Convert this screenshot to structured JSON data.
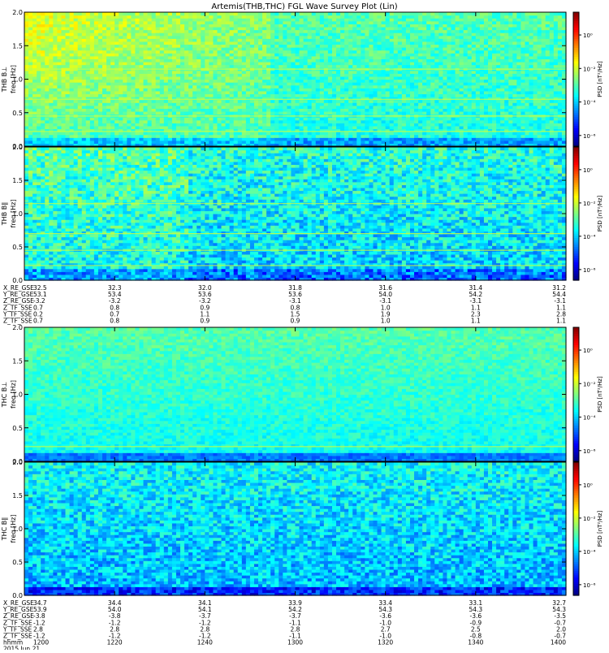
{
  "title": "Artemis(THB,THC) FGL Wave Survey Plot (Lin)",
  "colors": {
    "background": "#ffffff",
    "axis": "#000000",
    "colormap": [
      "#000080",
      "#0000ff",
      "#0080ff",
      "#00ffff",
      "#80ff80",
      "#ffff00",
      "#ff8000",
      "#ff0000",
      "#800000"
    ]
  },
  "chart_data": [
    {
      "type": "heatmap",
      "panel": "thb_bperp",
      "ylabel_probe": "THB B⊥",
      "ylabel": "freq [Hz]",
      "ylim": [
        0,
        2.0
      ],
      "yticks": [
        "0.0",
        "0.5",
        "1.0",
        "1.5",
        "2.0"
      ],
      "colorbar_label": "PSD [nT²/Hz]",
      "colorbar_ticks": [
        "10⁰",
        "10⁻²",
        "10⁻⁴",
        "10⁻⁶"
      ],
      "log_color_scale": true,
      "spectral_lines_hz": [
        0.22,
        0.45,
        0.7,
        1.15
      ]
    },
    {
      "type": "heatmap",
      "panel": "thb_bpar",
      "ylabel_probe": "THB B∥",
      "ylabel": "freq [Hz]",
      "ylim": [
        0,
        2.0
      ],
      "yticks": [
        "0.0",
        "0.5",
        "1.0",
        "1.5",
        "2.0"
      ],
      "colorbar_label": "PSD [nT²/Hz]",
      "colorbar_ticks": [
        "10⁰",
        "10⁻²",
        "10⁻⁴",
        "10⁻⁶"
      ],
      "log_color_scale": true,
      "spectral_lines_hz": [
        0.22,
        0.45,
        0.7,
        1.15
      ]
    },
    {
      "type": "heatmap",
      "panel": "thc_bperp",
      "ylabel_probe": "THC B⊥",
      "ylabel": "freq [Hz]",
      "ylim": [
        0,
        2.0
      ],
      "yticks": [
        "0.0",
        "0.5",
        "1.0",
        "1.5",
        "2.0"
      ],
      "colorbar_label": "PSD [nT²/Hz]",
      "colorbar_ticks": [
        "10⁰",
        "10⁻²",
        "10⁻⁴",
        "10⁻⁶"
      ],
      "log_color_scale": true,
      "spectral_lines_hz": [
        0.22
      ]
    },
    {
      "type": "heatmap",
      "panel": "thc_bpar",
      "ylabel_probe": "THC B∥",
      "ylabel": "freq [Hz]",
      "ylim": [
        0,
        2.0
      ],
      "yticks": [
        "0.0",
        "0.5",
        "1.0",
        "1.5",
        "2.0"
      ],
      "colorbar_label": "PSD [nT²/Hz]",
      "colorbar_ticks": [
        "10⁰",
        "10⁻²",
        "10⁻⁴",
        "10⁻⁶"
      ],
      "log_color_scale": true,
      "spectral_lines_hz": []
    }
  ],
  "thb_ephemeris": {
    "rows": [
      {
        "label": "X_RE_GSE",
        "values": [
          "32.5",
          "32.3",
          "32.0",
          "31.8",
          "31.6",
          "31.4",
          "31.2"
        ]
      },
      {
        "label": "Y_RE_GSE",
        "values": [
          "53.1",
          "53.4",
          "53.6",
          "53.6",
          "54.0",
          "54.2",
          "54.4"
        ]
      },
      {
        "label": "Z_RE_GSE",
        "values": [
          "-3.2",
          "-3.2",
          "-3.2",
          "-3.1",
          "-3.1",
          "-3.1",
          "-3.1"
        ]
      },
      {
        "label": "Z_TF_SSE",
        "values": [
          "0.7",
          "0.8",
          "0.9",
          "0.8",
          "1.0",
          "1.1",
          "1.1"
        ]
      },
      {
        "label": "Y_TF_SSE",
        "values": [
          "0.2",
          "0.7",
          "1.1",
          "1.5",
          "1.9",
          "2.3",
          "2.8"
        ]
      },
      {
        "label": "Z_TF_SSE",
        "values": [
          "0.7",
          "0.8",
          "0.9",
          "0.9",
          "1.0",
          "1.1",
          "1.1"
        ]
      }
    ]
  },
  "thc_ephemeris": {
    "rows": [
      {
        "label": "X_RE_GSE",
        "values": [
          "34.7",
          "34.4",
          "34.1",
          "33.9",
          "33.4",
          "33.1",
          "32.7"
        ]
      },
      {
        "label": "Y_RE_GSE",
        "values": [
          "53.9",
          "54.0",
          "54.1",
          "54.2",
          "54.3",
          "54.3",
          "54.3"
        ]
      },
      {
        "label": "Z_RE_GSE",
        "values": [
          "-3.8",
          "-3.8",
          "-3.7",
          "-3.7",
          "-3.6",
          "-3.6",
          "-3.5"
        ]
      },
      {
        "label": "Z_TF_SSE",
        "values": [
          "-1.2",
          "-1.2",
          "-1.2",
          "-1.1",
          "-1.0",
          "-0.9",
          "-0.7"
        ]
      },
      {
        "label": "Y_TF_SSE",
        "values": [
          "2.8",
          "2.8",
          "2.8",
          "2.8",
          "2.7",
          "2.5",
          "2.0"
        ]
      },
      {
        "label": "Z_TF_SSE",
        "values": [
          "-1.2",
          "-1.2",
          "-1.2",
          "-1.1",
          "-1.0",
          "-0.8",
          "-0.7"
        ]
      }
    ],
    "time_label": "hhmm",
    "times": [
      "1200",
      "1220",
      "1240",
      "1300",
      "1320",
      "1340",
      "1400"
    ],
    "date": "2015 Jun 21"
  }
}
